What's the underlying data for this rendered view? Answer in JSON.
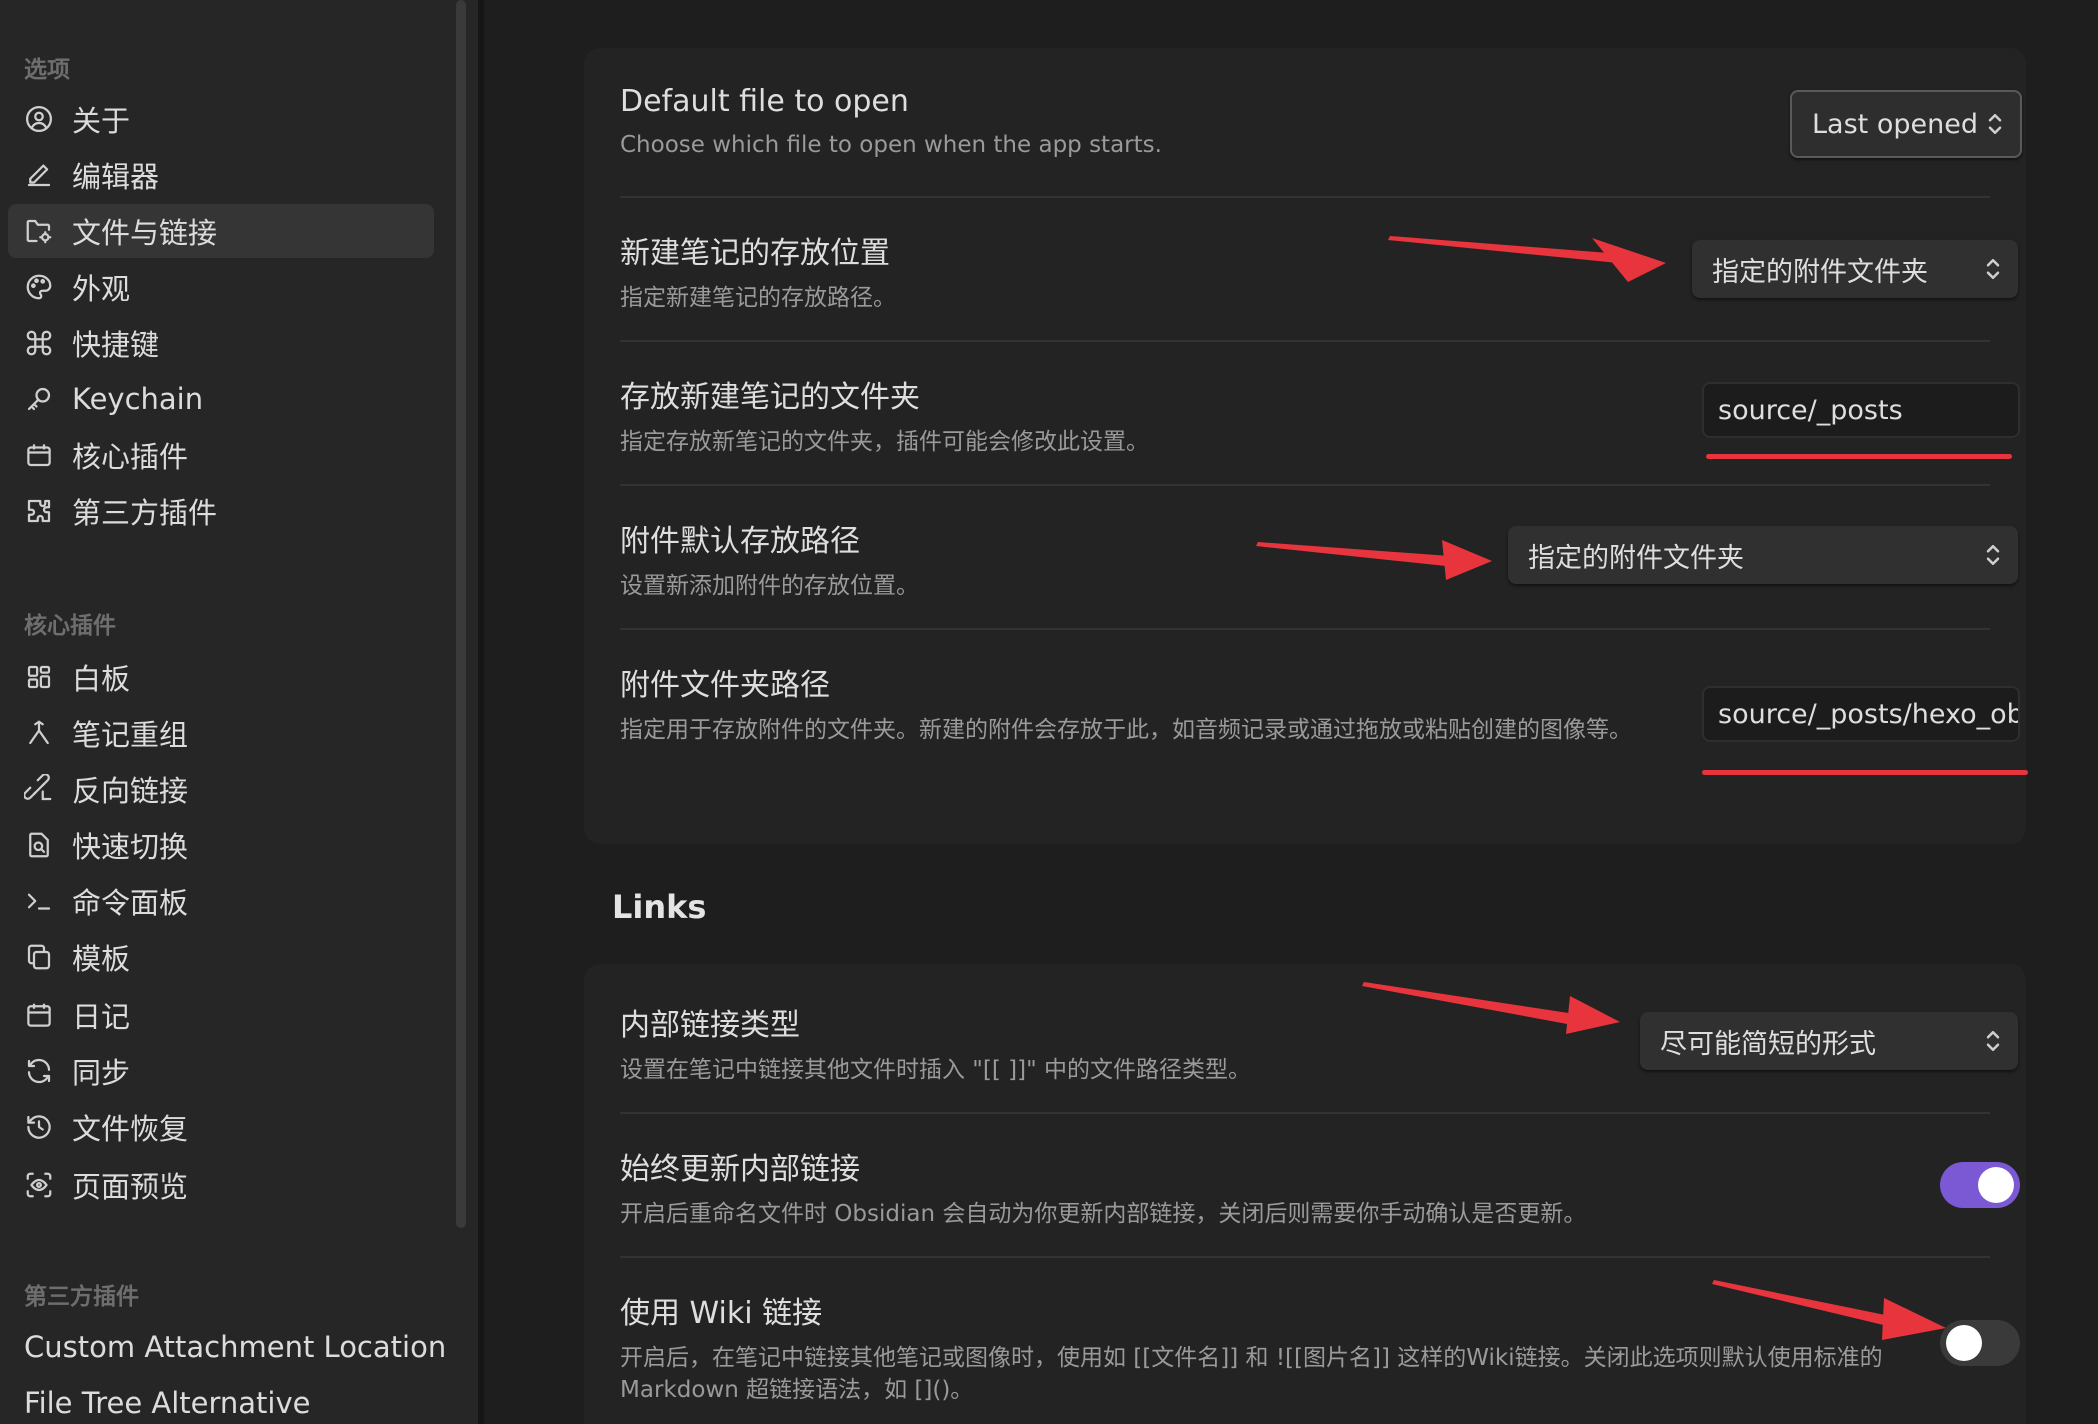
{
  "sidebar": {
    "groups": [
      {
        "title": "选项",
        "items": [
          {
            "label": "关于",
            "icon": "user-circle-icon"
          },
          {
            "label": "编辑器",
            "icon": "pencil-icon"
          },
          {
            "label": "文件与链接",
            "icon": "folder-cog-icon",
            "active": true
          },
          {
            "label": "外观",
            "icon": "palette-icon"
          },
          {
            "label": "快捷键",
            "icon": "command-icon"
          },
          {
            "label": "Keychain",
            "icon": "key-icon"
          },
          {
            "label": "核心插件",
            "icon": "calendar-box-icon"
          },
          {
            "label": "第三方插件",
            "icon": "puzzle-icon"
          }
        ]
      },
      {
        "title": "核心插件",
        "items": [
          {
            "label": "白板",
            "icon": "layout-grid-icon"
          },
          {
            "label": "笔记重组",
            "icon": "merge-icon"
          },
          {
            "label": "反向链接",
            "icon": "backlink-icon"
          },
          {
            "label": "快速切换",
            "icon": "file-search-icon"
          },
          {
            "label": "命令面板",
            "icon": "terminal-icon"
          },
          {
            "label": "模板",
            "icon": "copy-icon"
          },
          {
            "label": "日记",
            "icon": "calendar-icon"
          },
          {
            "label": "同步",
            "icon": "refresh-icon"
          },
          {
            "label": "文件恢复",
            "icon": "history-icon"
          },
          {
            "label": "页面预览",
            "icon": "scan-eye-icon"
          }
        ]
      },
      {
        "title": "第三方插件",
        "items": [
          {
            "label": "Custom Attachment Location"
          },
          {
            "label": "File Tree Alternative"
          }
        ]
      }
    ]
  },
  "files": {
    "default_file": {
      "title": "Default file to open",
      "desc": "Choose which file to open when the app starts.",
      "value": "Last opened"
    },
    "new_note_location": {
      "title": "新建笔记的存放位置",
      "desc": "指定新建笔记的存放路径。",
      "value": "指定的附件文件夹"
    },
    "new_note_folder": {
      "title": "存放新建笔记的文件夹",
      "desc": "指定存放新笔记的文件夹，插件可能会修改此设置。",
      "value": "source/_posts"
    },
    "attachment_location": {
      "title": "附件默认存放路径",
      "desc": "设置新添加附件的存放位置。",
      "value": "指定的附件文件夹"
    },
    "attachment_folder": {
      "title": "附件文件夹路径",
      "desc": "指定用于存放附件的文件夹。新建的附件会存放于此，如音频记录或通过拖放或粘贴创建的图像等。",
      "value": "source/_posts/hexo_ob"
    }
  },
  "links": {
    "heading": "Links",
    "link_format": {
      "title": "内部链接类型",
      "desc": "设置在笔记中链接其他文件时插入 \"[[ ]]\" 中的文件路径类型。",
      "value": "尽可能简短的形式"
    },
    "auto_update": {
      "title": "始终更新内部链接",
      "desc": "开启后重命名文件时 Obsidian 会自动为你更新内部链接，关闭后则需要你手动确认是否更新。",
      "enabled": true
    },
    "wiki_links": {
      "title": "使用 Wiki 链接",
      "desc": "开启后，在笔记中链接其他笔记或图像时，使用如 [[文件名]] 和 ![[图片名]] 这样的Wiki链接。关闭此选项则默认使用标准的 Markdown 超链接语法，如 []()。",
      "enabled": false
    }
  },
  "colors": {
    "accent": "#7b59d4",
    "annotation_red": "#e8343c",
    "background": "#1e1e1e",
    "sidebar": "#262626"
  }
}
